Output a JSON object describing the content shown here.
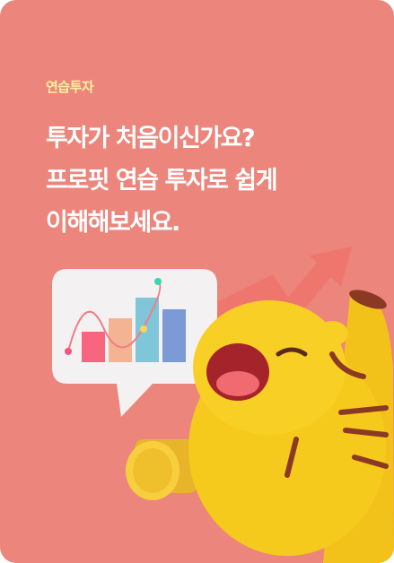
{
  "card": {
    "category_label": "연습투자",
    "headline_lines": [
      "투자가 처음이신가요?",
      "프로핏 연습 투자로 쉽게",
      "이해해보세요."
    ]
  },
  "colors": {
    "background": "#ec857b",
    "label": "#fff3a0",
    "text": "#ffffff"
  }
}
